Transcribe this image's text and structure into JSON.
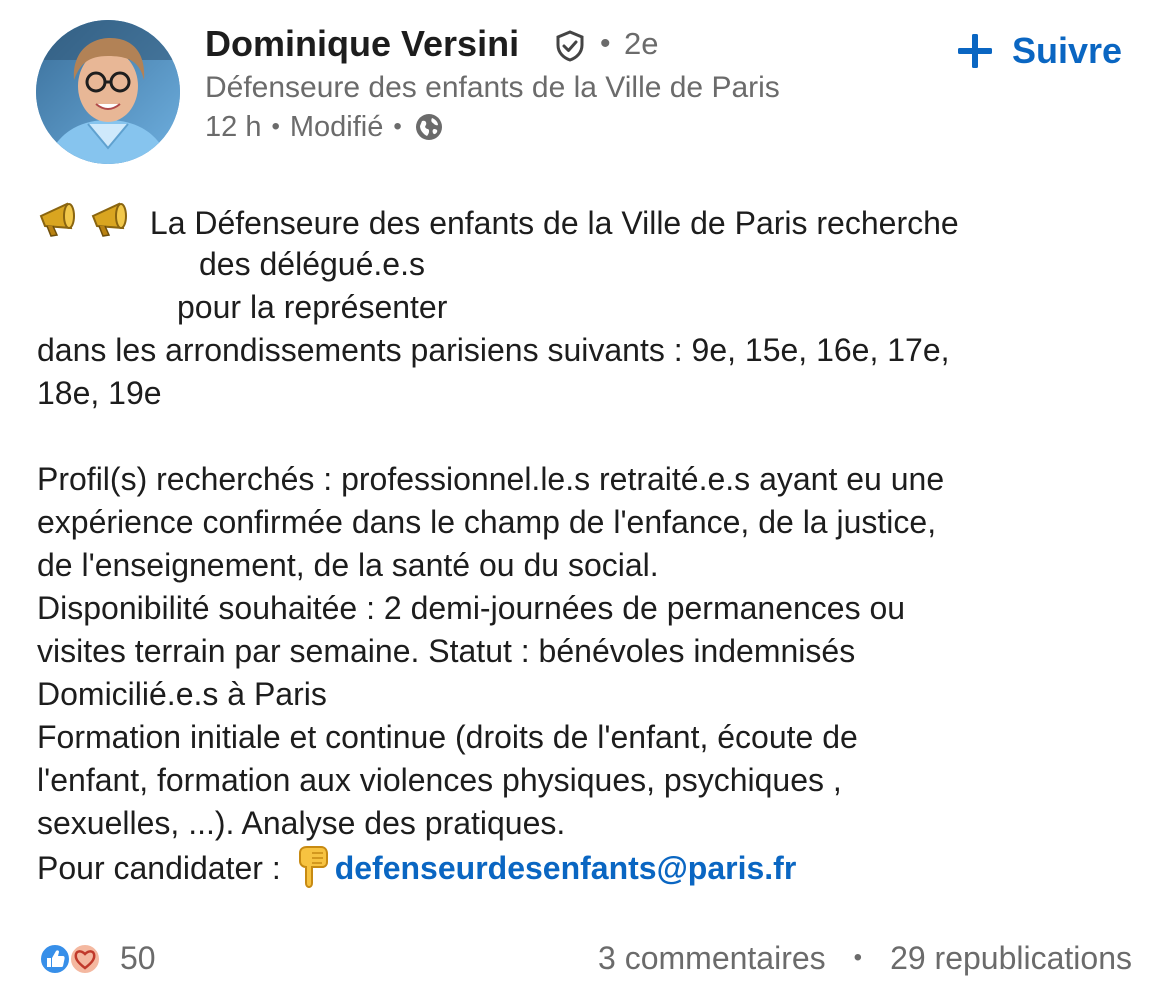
{
  "author": {
    "name": "Dominique Versini",
    "connection_degree": "2e",
    "headline": "Défenseure des enfants de la Ville de Paris",
    "time": "12 h",
    "edited": "Modifié",
    "visibility_icon": "globe-icon",
    "verified_icon": "shield-check-icon"
  },
  "follow": {
    "label": "Suivre",
    "icon": "plus-icon"
  },
  "post": {
    "line1": "La Défenseure des enfants de la Ville de Paris recherche",
    "line2": "des délégué.e.s",
    "line3": "pour la représenter",
    "line4": "dans les arrondissements parisiens suivants : 9e, 15e, 16e, 17e,",
    "line5": "18e, 19e",
    "line6": "Profil(s) recherchés : professionnel.le.s retraité.e.s ayant eu une",
    "line7": "expérience confirmée dans le champ de l'enfance, de la justice,",
    "line8": "de l'enseignement, de la santé ou du social.",
    "line9": "Disponibilité souhaitée : 2 demi-journées de permanences ou",
    "line10": "visites terrain par semaine. Statut : bénévoles indemnisés",
    "line11": "Domicilié.e.s à Paris",
    "line12": "Formation initiale et continue (droits de l'enfant, écoute de",
    "line13": "l'enfant, formation aux violences physiques, psychiques ,",
    "line14": "sexuelles, ...). Analyse des pratiques.",
    "line15": "Pour candidater :",
    "email": "defenseurdesenfants@paris.fr"
  },
  "footer": {
    "reaction_count": "50",
    "comments": "3 commentaires",
    "reposts": "29 republications"
  },
  "colors": {
    "link": "#0a66c2",
    "muted_text": "#6b6b6b",
    "body_text": "#1d1d1d"
  }
}
